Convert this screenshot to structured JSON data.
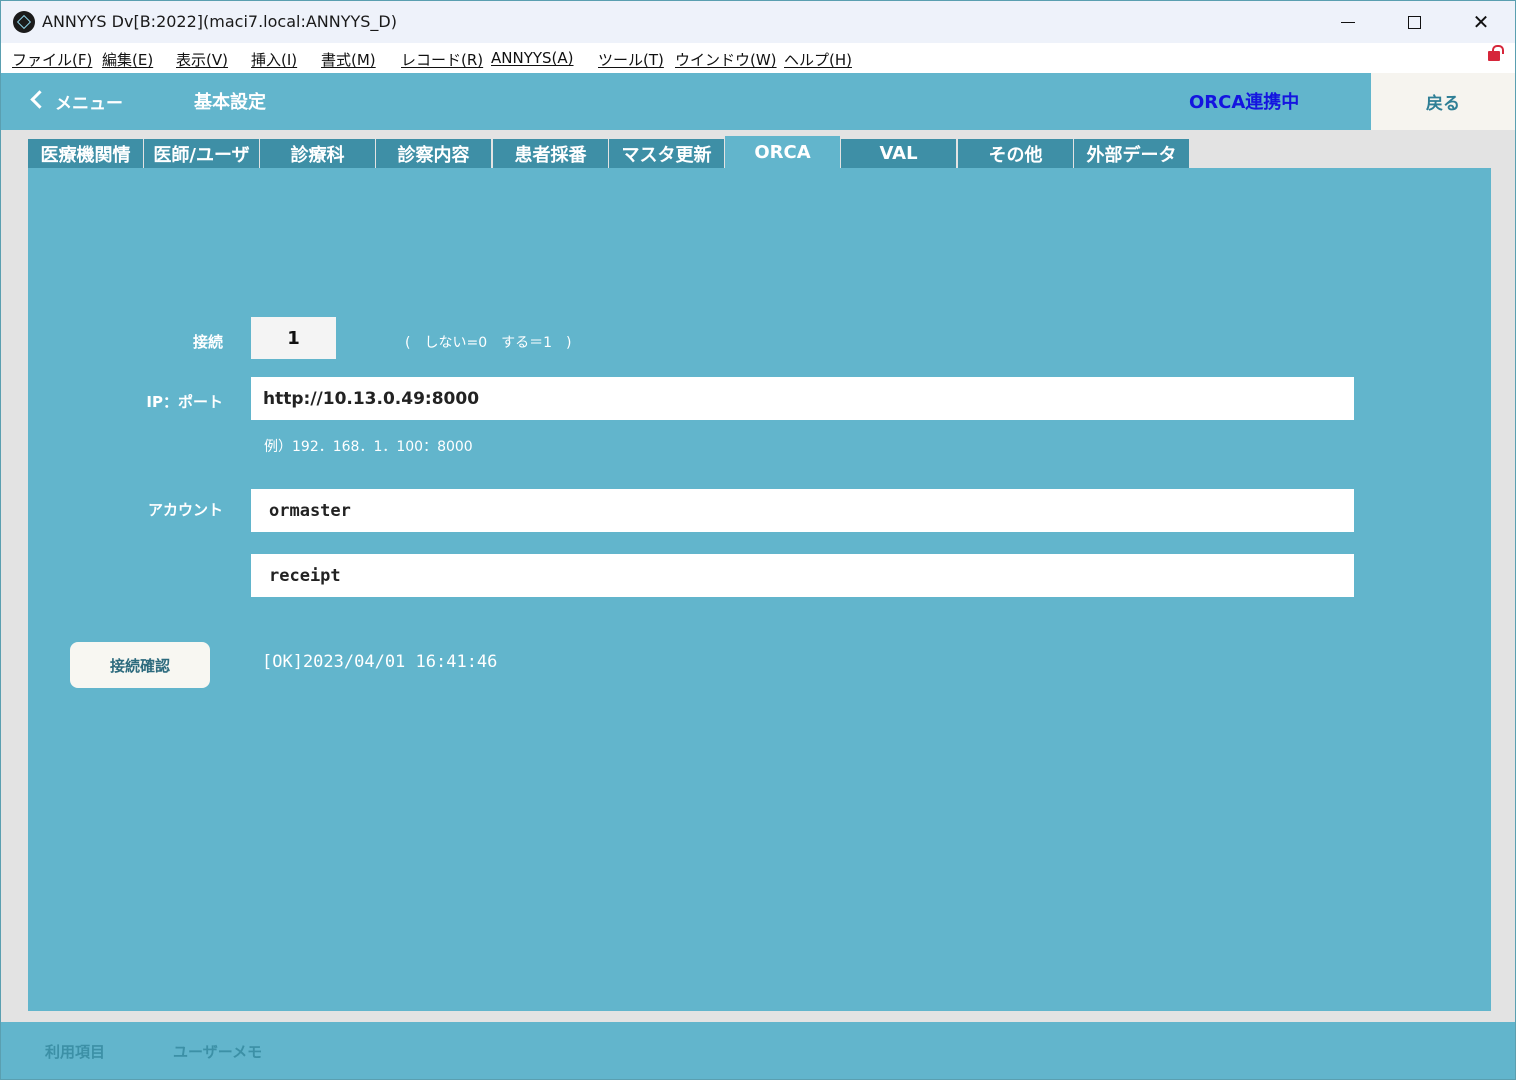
{
  "window": {
    "title": "ANNYYS Dv[B:2022](maci7.local:ANNYYS_D)",
    "controls": {
      "minimize": "—",
      "maximize": "□",
      "close": "✕"
    }
  },
  "menubar": {
    "items": [
      "ファイル(F)",
      "編集(E)",
      "表示(V)",
      "挿入(I)",
      "書式(M)",
      "レコード(R)",
      "ANNYYS(A)",
      "ツール(T)",
      "ウインドウ(W)",
      "ヘルプ(H)"
    ],
    "lock_icon": "unlocked-lock-icon",
    "lock_color": "#d6263a"
  },
  "header": {
    "menu_link": "メニュー",
    "title": "基本設定",
    "status": "ORCA連携中",
    "status_color": "#1414e0",
    "back_button": "戻る"
  },
  "tabs": [
    {
      "label": "医療機関情",
      "active": false
    },
    {
      "label": "医師/ユーザ",
      "active": false
    },
    {
      "label": "診療科",
      "active": false
    },
    {
      "label": "診察内容",
      "active": false
    },
    {
      "label": "患者採番",
      "active": false
    },
    {
      "label": "マスタ更新",
      "active": false
    },
    {
      "label": "ORCA",
      "active": true
    },
    {
      "label": "VAL",
      "active": false
    },
    {
      "label": "その他",
      "active": false
    },
    {
      "label": "外部データ",
      "active": false
    }
  ],
  "orca": {
    "connection_label": "接続",
    "connection_value": "1",
    "connection_hint": "(　しない=0　する＝1　)",
    "ip_label": "IP：ポート",
    "ip_value": "http://10.13.0.49:8000",
    "ip_example": "例）192．168．1．100：8000",
    "account_label": "アカウント",
    "account_value": "ormaster",
    "password_value": "receipt",
    "confirm_button": "接続確認",
    "confirm_result": "[OK]2023/04/01 16:41:46"
  },
  "footer": {
    "items": [
      "利用項目",
      "ユーザーメモ"
    ]
  },
  "colors": {
    "accent": "#62b5cc",
    "tab_inactive": "#3e8fa6"
  }
}
